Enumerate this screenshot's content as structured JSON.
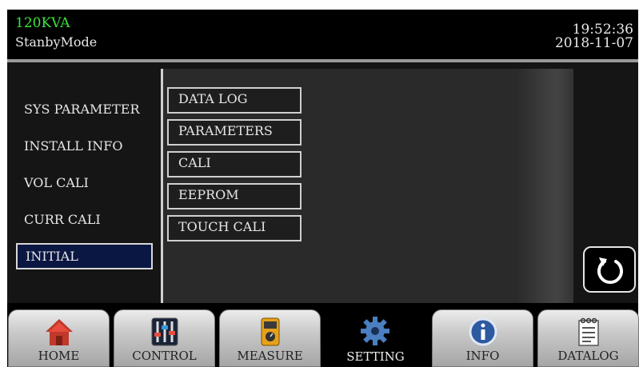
{
  "header": {
    "model": "120KVA",
    "mode": "StanbyMode",
    "time": "19:52:36",
    "date": "2018-11-07"
  },
  "left_menu": {
    "items": [
      {
        "label": "SYS PARAMETER"
      },
      {
        "label": "INSTALL INFO"
      },
      {
        "label": "VOL CALI"
      },
      {
        "label": "CURR CALI"
      },
      {
        "label": "INITIAL",
        "selected": true
      }
    ]
  },
  "sub_menu": {
    "items": [
      {
        "label": "DATA LOG"
      },
      {
        "label": "PARAMETERS"
      },
      {
        "label": "CALI"
      },
      {
        "label": "EEPROM"
      },
      {
        "label": "TOUCH CALI"
      }
    ]
  },
  "back_button": {
    "icon": "refresh-icon"
  },
  "nav": {
    "active": "SETTING",
    "tabs": [
      {
        "label": "HOME",
        "icon": "home-icon"
      },
      {
        "label": "CONTROL",
        "icon": "sliders-icon"
      },
      {
        "label": "MEASURE",
        "icon": "multimeter-icon"
      },
      {
        "label": "SETTING",
        "icon": "gear-icon"
      },
      {
        "label": "INFO",
        "icon": "info-icon"
      },
      {
        "label": "DATALOG",
        "icon": "notepad-icon"
      }
    ]
  },
  "colors": {
    "model_text": "#3de23d",
    "selected_bg": "#0a1742"
  }
}
